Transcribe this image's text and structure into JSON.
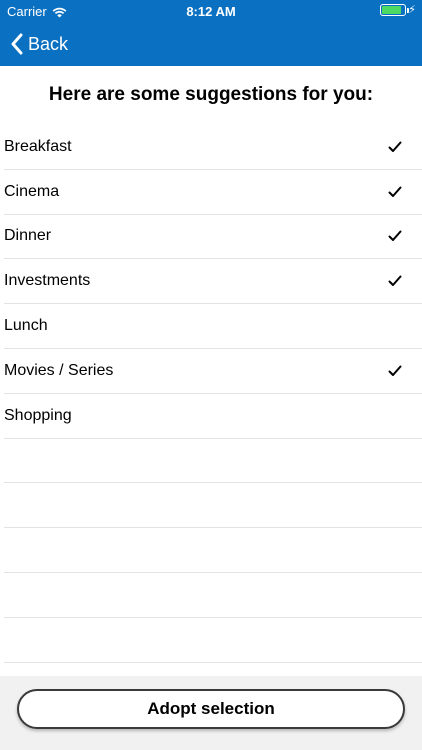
{
  "status_bar": {
    "carrier": "Carrier",
    "time": "8:12 AM",
    "battery_level": 0.85,
    "colors": {
      "bar": "#0a71c2",
      "battery": "#4cd964"
    }
  },
  "nav": {
    "back_label": "Back"
  },
  "title": "Here are some suggestions for you:",
  "items": [
    {
      "label": "Breakfast",
      "checked": true
    },
    {
      "label": "Cinema",
      "checked": true
    },
    {
      "label": "Dinner",
      "checked": true
    },
    {
      "label": "Investments",
      "checked": true
    },
    {
      "label": "Lunch",
      "checked": false
    },
    {
      "label": "Movies / Series",
      "checked": true
    },
    {
      "label": "Shopping",
      "checked": false
    }
  ],
  "empty_rows": 5,
  "adopt_button_label": "Adopt selection",
  "icons": {
    "wifi": "wifi-icon",
    "battery": "battery-icon",
    "charging": "bolt-icon",
    "back": "chevron-left-icon",
    "checked": "check-icon"
  }
}
